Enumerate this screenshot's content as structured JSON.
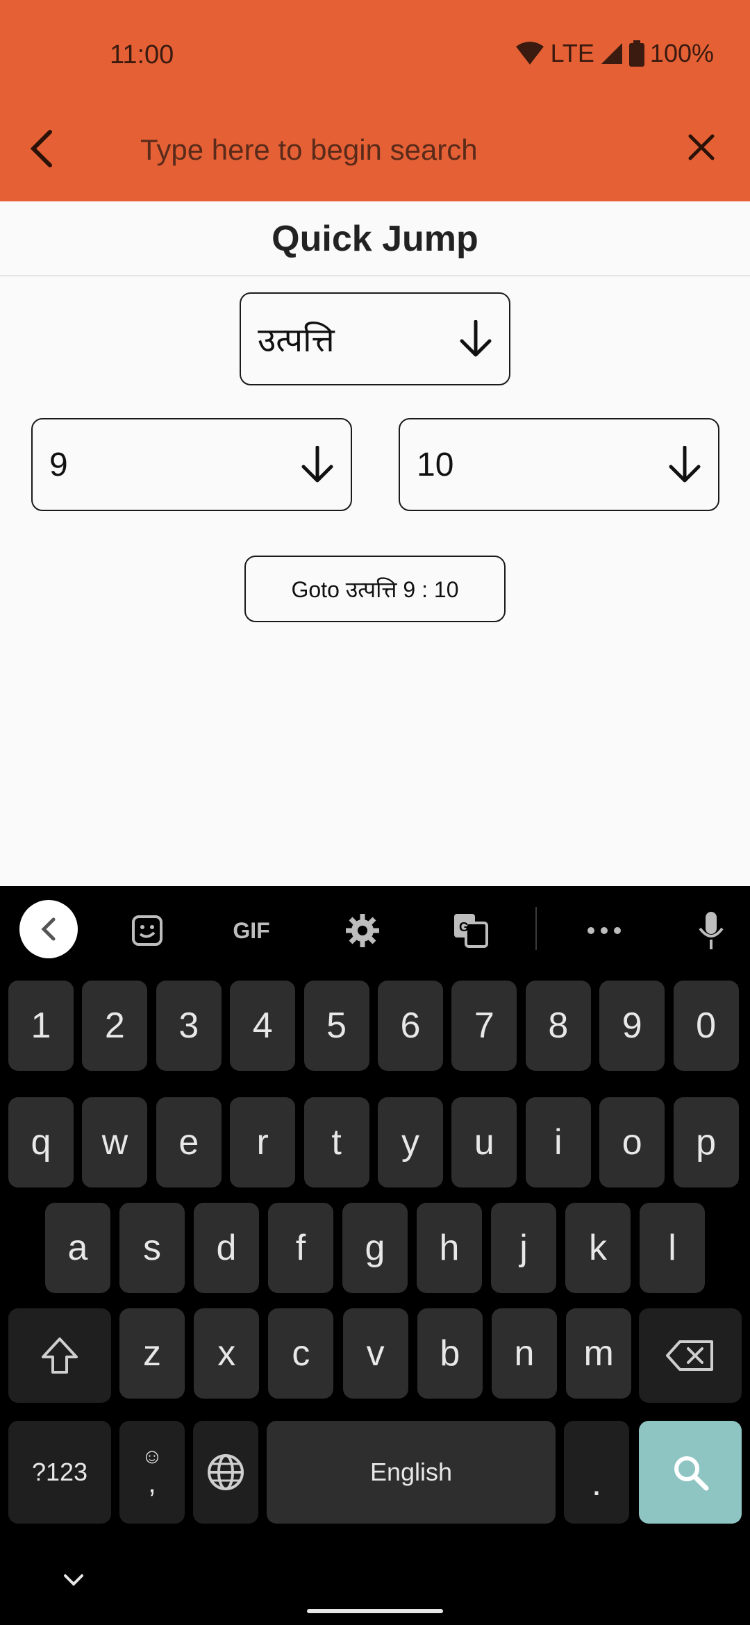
{
  "status_bar": {
    "time": "11:00",
    "network": "LTE",
    "battery": "100%"
  },
  "search": {
    "placeholder": "Type here to begin search"
  },
  "quick_jump": {
    "title": "Quick Jump",
    "book": "उत्पत्ति",
    "chapter": "9",
    "verse": "10",
    "goto_label": "Goto उत्पत्ति 9 : 10"
  },
  "keyboard": {
    "toolbar": {
      "gif_label": "GIF"
    },
    "rows": [
      [
        "1",
        "2",
        "3",
        "4",
        "5",
        "6",
        "7",
        "8",
        "9",
        "0"
      ],
      [
        "q",
        "w",
        "e",
        "r",
        "t",
        "y",
        "u",
        "i",
        "o",
        "p"
      ],
      [
        "a",
        "s",
        "d",
        "f",
        "g",
        "h",
        "j",
        "k",
        "l"
      ],
      [
        "z",
        "x",
        "c",
        "v",
        "b",
        "n",
        "m"
      ]
    ],
    "symbols_label": "?123",
    "comma_label": ",",
    "space_label": "English",
    "period_label": ".",
    "accent_color": "#8ec5c3"
  },
  "colors": {
    "header": "#e56135",
    "background": "#fafafa"
  }
}
